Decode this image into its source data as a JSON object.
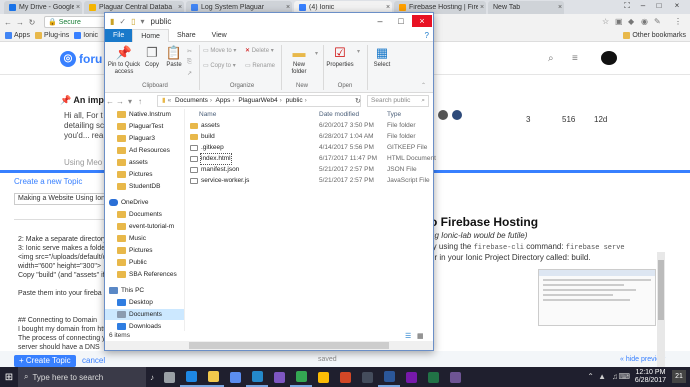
{
  "browser": {
    "tabs": [
      {
        "label": "My Drive - Google Drive",
        "color": "#1a73e8"
      },
      {
        "label": "Plaguar Central Databa",
        "color": "#f4b400"
      },
      {
        "label": "Log System Plaguar",
        "color": "#4285f4"
      },
      {
        "label": "(4) Ionic",
        "color": "#3880ff"
      },
      {
        "label": "Firebase Hosting | Fire",
        "color": "#ffa000"
      },
      {
        "label": "New Tab",
        "color": "#cfd3d8"
      }
    ],
    "address_label": "Secure",
    "bookmarks": [
      {
        "label": "Apps",
        "color": "#4285f4"
      },
      {
        "label": "Plug-ins",
        "color": "#e8b84a"
      },
      {
        "label": "Ionic",
        "color": "#3880ff"
      }
    ],
    "other_bookmarks": "Other bookmarks"
  },
  "forum": {
    "logo_text": "foru",
    "pinned_title": "An impo",
    "snippets": [
      "Hi all, For t",
      "detailing sc",
      "you'd... rea"
    ],
    "stats": [
      "3",
      "516",
      "12d"
    ],
    "unseen_prefix": "Using Meo"
  },
  "composer": {
    "title": "Create a new Topic",
    "topic_title": "Making a Website Using Ion",
    "editor_lines": [
      "2: Make a separate directory",
      "3: Ionic serve makes a folder",
      "<img src=\"/uploads/default/o",
      "width=\"600\" height=\"300\">",
      "Copy \"build\" (and \"assets\" if",
      "",
      "Paste them into your fireba",
      "",
      "",
      "## Connecting to Domain",
      "I bought my domain from htt",
      "The process of connecting y",
      "server should have a DNS"
    ],
    "preview_heading": "o Firebase Hosting",
    "preview_sub": "ng Ionic-lab would be futile)",
    "preview_line1_prefix": "ry using the ",
    "preview_line1_code": "firebase-cli",
    "preview_line1_mid": " command: ",
    "preview_line1_code2": "firebase serve",
    "preview_line2": "er in your Ionic Project Directory called: build.",
    "create_label": "+ Create Topic",
    "cancel_label": "cancel",
    "saved_label": "saved",
    "hide_preview_label": "« hide preview"
  },
  "explorer": {
    "title": "public",
    "ribbon_tabs": [
      "File",
      "Home",
      "Share",
      "View"
    ],
    "ribbon": {
      "pin": "Pin to Quick access",
      "copy": "Copy",
      "paste": "Paste",
      "move_to": "Move to",
      "copy_to": "Copy to",
      "delete": "Delete",
      "rename": "Rename",
      "new_folder": "New folder",
      "properties": "Properties",
      "select": "Select",
      "group_clipboard": "Clipboard",
      "group_organize": "Organize",
      "group_new": "New",
      "group_open": "Open"
    },
    "path": [
      "Documents",
      "Apps",
      "PlaguarWeb4",
      "public"
    ],
    "search_placeholder": "Search public",
    "nav_items": [
      {
        "label": "Native.Instrum",
        "kind": "fold"
      },
      {
        "label": "PlaguarTest",
        "kind": "fold"
      },
      {
        "label": "Plaguar3",
        "kind": "fold"
      },
      {
        "label": "Ad Resources",
        "kind": "fold"
      },
      {
        "label": "assets",
        "kind": "fold"
      },
      {
        "label": "Pictures",
        "kind": "fold"
      },
      {
        "label": "StudentDB",
        "kind": "fold"
      },
      {
        "label": "OneDrive",
        "kind": "cloud"
      },
      {
        "label": "Documents",
        "kind": "fold"
      },
      {
        "label": "event-tutorial-m",
        "kind": "fold"
      },
      {
        "label": "Music",
        "kind": "fold"
      },
      {
        "label": "Pictures",
        "kind": "fold"
      },
      {
        "label": "Public",
        "kind": "fold"
      },
      {
        "label": "SBA References",
        "kind": "fold"
      },
      {
        "label": "This PC",
        "kind": "pc"
      },
      {
        "label": "Desktop",
        "kind": "blue"
      },
      {
        "label": "Documents",
        "kind": "gray"
      },
      {
        "label": "Downloads",
        "kind": "blue"
      }
    ],
    "columns": [
      "Name",
      "Date modified",
      "Type"
    ],
    "files": [
      {
        "name": "assets",
        "date": "6/20/2017 3:50 PM",
        "type": "File folder",
        "kind": "fold"
      },
      {
        "name": "build",
        "date": "6/28/2017 1:04 AM",
        "type": "File folder",
        "kind": "fold"
      },
      {
        "name": ".gitkeep",
        "date": "4/14/2017 5:56 PM",
        "type": "GITKEEP File",
        "kind": "doc"
      },
      {
        "name": "index.html",
        "date": "6/17/2017 11:47 PM",
        "type": "HTML Document",
        "kind": "doc"
      },
      {
        "name": "manifest.json",
        "date": "5/21/2017 2:57 PM",
        "type": "JSON File",
        "kind": "doc"
      },
      {
        "name": "service-worker.js",
        "date": "5/21/2017 2:57 PM",
        "type": "JavaScript File",
        "kind": "doc"
      }
    ],
    "status": "6 items"
  },
  "taskbar": {
    "search_placeholder": "Type here to search",
    "time": "12:10 PM",
    "date": "6/28/2017",
    "notif_count": "21",
    "apps": [
      {
        "name": "task-view",
        "color": "#9aa0a6"
      },
      {
        "name": "edge",
        "color": "#1e88e5"
      },
      {
        "name": "file-explorer",
        "color": "#f2c94c"
      },
      {
        "name": "store",
        "color": "#5b8def"
      },
      {
        "name": "visual-studio-code",
        "color": "#2489ca"
      },
      {
        "name": "visual-studio",
        "color": "#7e57c2"
      },
      {
        "name": "chrome",
        "color": "#34a853"
      },
      {
        "name": "chrome-2",
        "color": "#fbbc05"
      },
      {
        "name": "powerpoint",
        "color": "#d24726"
      },
      {
        "name": "photos",
        "color": "#444c5c"
      },
      {
        "name": "word",
        "color": "#2b579a"
      },
      {
        "name": "onenote",
        "color": "#7719aa"
      },
      {
        "name": "excel",
        "color": "#217346"
      },
      {
        "name": "github-desktop",
        "color": "#6e5494"
      }
    ]
  }
}
